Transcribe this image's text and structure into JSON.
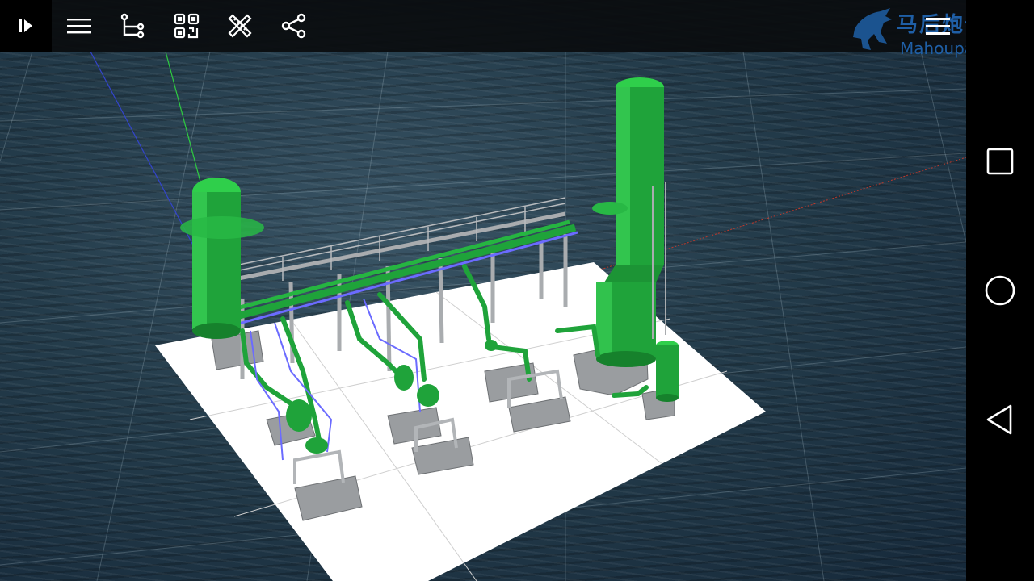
{
  "toolbar": {
    "items": [
      {
        "name": "play-icon"
      },
      {
        "name": "menu-icon"
      },
      {
        "name": "tree-icon"
      },
      {
        "name": "qr-code-icon"
      },
      {
        "name": "measure-tool-icon"
      },
      {
        "name": "share-icon"
      }
    ]
  },
  "watermark": {
    "text_cn": "马后炮化工",
    "text_en": "Mahoupao.net"
  },
  "navbar": {
    "items": [
      {
        "name": "recent-apps-icon"
      },
      {
        "name": "home-icon"
      },
      {
        "name": "back-icon"
      }
    ]
  },
  "colors": {
    "equipment": "#1fa33a",
    "steel": "#a9acaf",
    "piping_blue": "#6b6bff",
    "floor": "#ffffff",
    "water": "#243c4b",
    "toolbar": "#0a0c0e",
    "watermark": "#1f5fa6"
  }
}
